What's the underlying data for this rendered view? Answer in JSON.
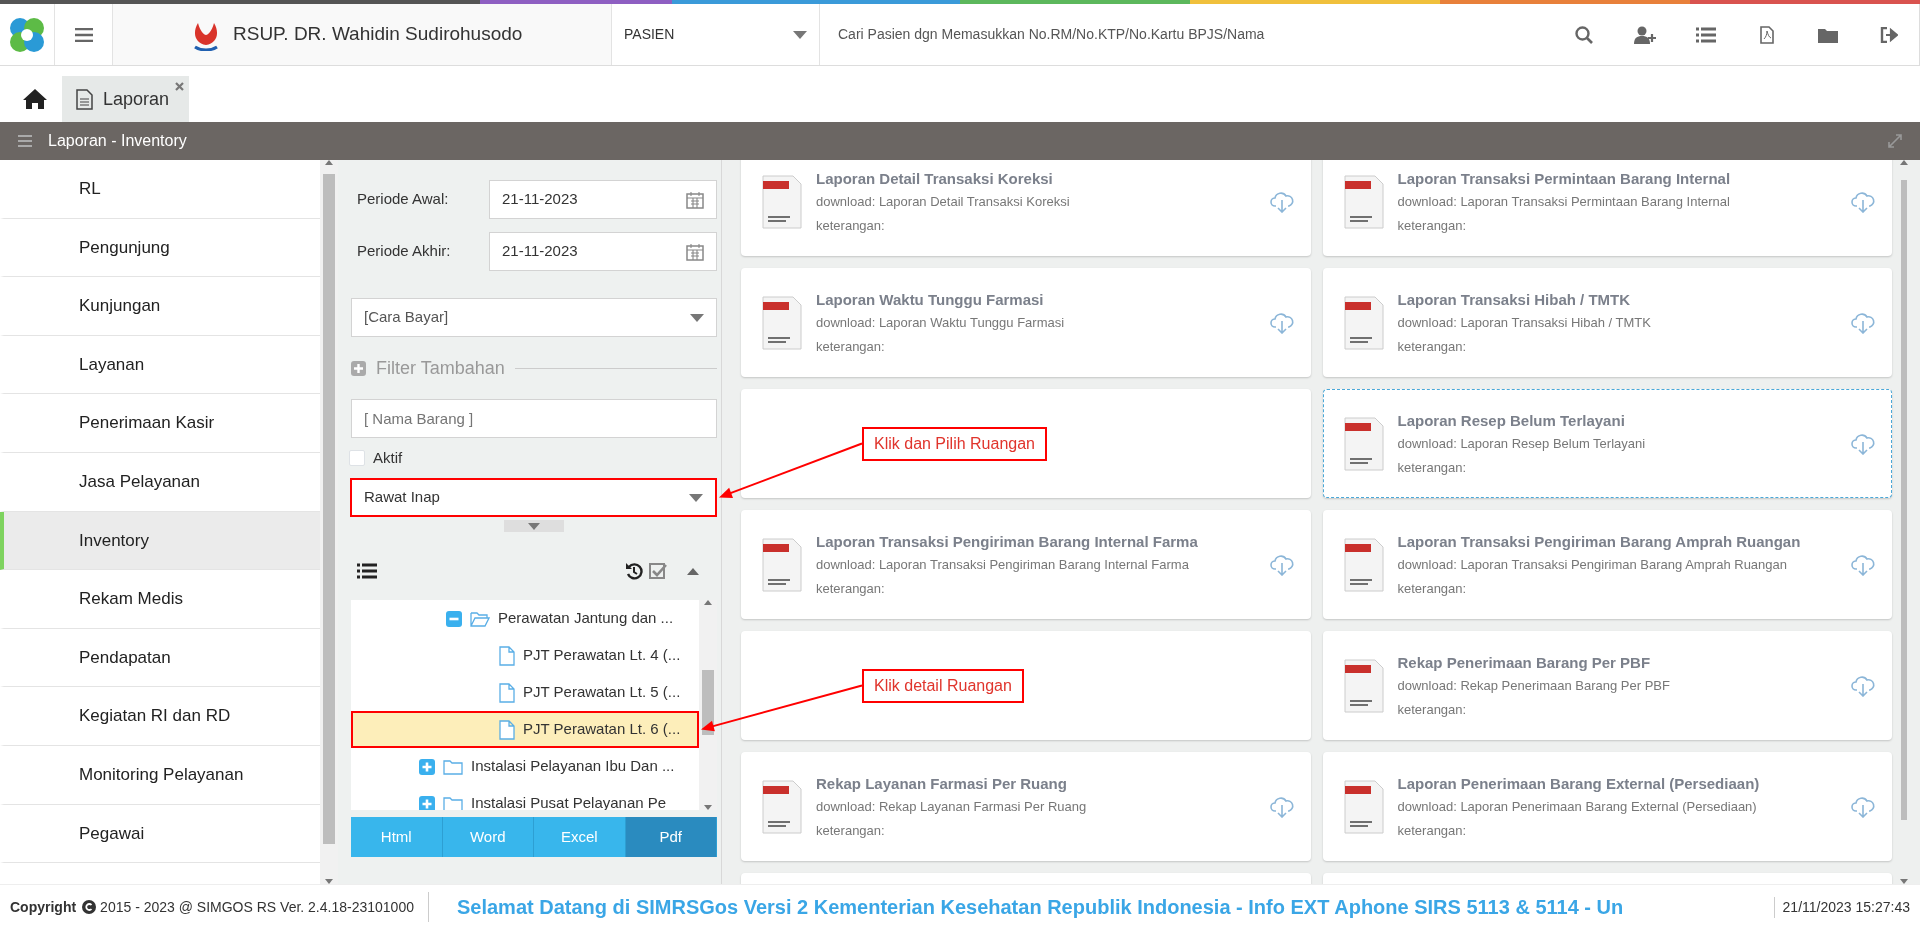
{
  "header": {
    "brand": "RSUP. DR. Wahidin Sudirohusodo",
    "patient_type": "PASIEN",
    "search": {
      "placeholder": "Cari Pasien dgn Memasukkan No.RM/No.KTP/No.Kartu BPJS/Nama"
    }
  },
  "tabs": [
    {
      "label": "Laporan",
      "selected": true
    }
  ],
  "panel_title": "Laporan - Inventory",
  "sidebar": {
    "items": [
      {
        "label": "RL",
        "selected": false
      },
      {
        "label": "Pengunjung",
        "selected": false
      },
      {
        "label": "Kunjungan",
        "selected": false
      },
      {
        "label": "Layanan",
        "selected": false
      },
      {
        "label": "Penerimaan Kasir",
        "selected": false
      },
      {
        "label": "Jasa Pelayanan",
        "selected": false
      },
      {
        "label": "Inventory",
        "selected": true
      },
      {
        "label": "Rekam Medis",
        "selected": false
      },
      {
        "label": "Pendapatan",
        "selected": false
      },
      {
        "label": "Kegiatan RI dan RD",
        "selected": false
      },
      {
        "label": "Monitoring Pelayanan",
        "selected": false
      },
      {
        "label": "Pegawai",
        "selected": false
      }
    ]
  },
  "filters": {
    "periode_awal": {
      "label": "Periode Awal:",
      "value": "21-11-2023"
    },
    "periode_akhir": {
      "label": "Periode Akhir:",
      "value": "21-11-2023"
    },
    "cara_bayar": {
      "value": "[Cara Bayar]"
    },
    "filter_tambahan": "Filter Tambahan",
    "nama_barang": {
      "placeholder": "[ Nama Barang ]"
    },
    "aktif": {
      "label": "Aktif",
      "checked": false
    },
    "ruangan": {
      "value": "Rawat Inap",
      "highlighted": true
    }
  },
  "tree": {
    "items": [
      {
        "children": [
          {
            "label": "Perawatan Jantung dan ...",
            "expanded": true,
            "selected": false,
            "highlighted": false,
            "children": [
              {
                "label": "PJT Perawatan Lt. 4 (...",
                "selected": false,
                "highlighted": false
              },
              {
                "label": "PJT Perawatan Lt. 5 (...",
                "selected": false,
                "highlighted": false
              },
              {
                "label": "PJT Perawatan Lt. 6 (...",
                "selected": true,
                "highlighted": true
              }
            ]
          }
        ]
      },
      {
        "label": "Instalasi Pelayanan Ibu Dan ...",
        "expanded": false,
        "selected": false,
        "highlighted": false
      },
      {
        "label": "Instalasi Pusat Pelayanan Pe",
        "expanded": false,
        "selected": false,
        "highlighted": false
      }
    ]
  },
  "export_buttons": [
    {
      "label": "Html",
      "selected": false
    },
    {
      "label": "Word",
      "selected": false
    },
    {
      "label": "Excel",
      "selected": false
    },
    {
      "label": "Pdf",
      "selected": true
    }
  ],
  "reports": [
    {
      "kind": "report",
      "title": "Laporan Detail Transaksi Koreksi",
      "download": "download: Laporan Detail Transaksi Koreksi",
      "note": "keterangan:",
      "focused": false
    },
    {
      "kind": "report",
      "title": "Laporan Transaksi Permintaan Barang Internal",
      "download": "download: Laporan Transaksi Permintaan Barang Internal",
      "note": "keterangan:",
      "focused": false
    },
    {
      "kind": "report",
      "title": "Laporan Waktu Tunggu Farmasi",
      "download": "download: Laporan Waktu Tunggu Farmasi",
      "note": "keterangan:",
      "focused": false
    },
    {
      "kind": "report",
      "title": "Laporan Transaksi Hibah / TMTK",
      "download": "download: Laporan Transaksi Hibah / TMTK",
      "note": "keterangan:",
      "focused": false
    },
    {
      "kind": "annotation",
      "text": "Klik dan Pilih Ruangan"
    },
    {
      "kind": "report",
      "title": "Laporan Resep Belum Terlayani",
      "download": "download: Laporan Resep Belum Terlayani",
      "note": "keterangan:",
      "focused": true
    },
    {
      "kind": "report",
      "title": "Laporan Transaksi Pengiriman Barang Internal Farma",
      "download": "download: Laporan Transaksi Pengiriman Barang Internal Farma",
      "note": "keterangan:",
      "focused": false
    },
    {
      "kind": "report",
      "title": "Laporan Transaksi Pengiriman Barang Amprah Ruangan",
      "download": "download: Laporan Transaksi Pengiriman Barang Amprah Ruangan",
      "note": "keterangan:",
      "focused": false
    },
    {
      "kind": "annotation",
      "text": "Klik detail Ruangan"
    },
    {
      "kind": "report",
      "title": "Rekap Penerimaan Barang Per PBF",
      "download": "download: Rekap Penerimaan Barang Per PBF",
      "note": "keterangan:",
      "focused": false
    },
    {
      "kind": "report",
      "title": "Rekap Layanan Farmasi Per Ruang",
      "download": "download: Rekap Layanan Farmasi Per Ruang",
      "note": "keterangan:",
      "focused": false
    },
    {
      "kind": "report",
      "title": "Laporan Penerimaan Barang External (Persediaan)",
      "download": "download: Laporan Penerimaan Barang External (Persediaan)",
      "note": "keterangan:",
      "focused": false
    },
    {
      "kind": "blank"
    },
    {
      "kind": "blank"
    }
  ],
  "footer": {
    "copyright_label": "Copyright",
    "copyright_text": "2015 - 2023 @ SIMGOS RS Ver. 2.4.18-23101000",
    "ticker": "Selamat Datang di SIMRSGos Versi 2 Kementerian Kesehatan Republik Indonesia - Info EXT Aphone SIRS 5113 & 5114 - Un",
    "datetime": "21/11/2023 15:27:43"
  }
}
